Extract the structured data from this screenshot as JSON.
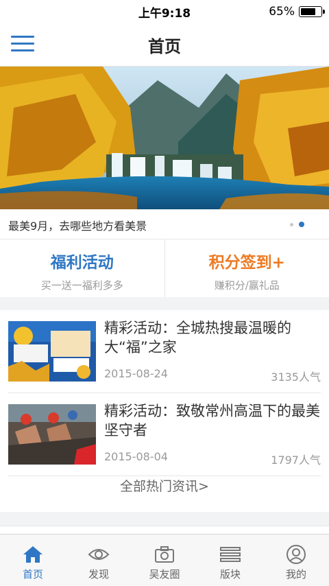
{
  "status": {
    "time": "上午9:18",
    "battery": "65%"
  },
  "header": {
    "title": "首页",
    "menu_icon": "hamburger-menu-icon"
  },
  "banner": {
    "caption": "最美9月，去哪些地方看美景",
    "slide_count": 2,
    "active_slide": 2
  },
  "promo": [
    {
      "title": "福利活动",
      "subtitle": "买一送一福利多多",
      "color": "#2f77c4"
    },
    {
      "title": "积分签到+",
      "subtitle": "赚积分/赢礼品",
      "color": "#ee7a22"
    }
  ],
  "news": {
    "items": [
      {
        "title": "精彩活动：全城热搜最温暖的大“福”之家",
        "date": "2015-08-24",
        "views": "3135",
        "views_unit": "人气"
      },
      {
        "title": "精彩活动：致敬常州高温下的最美坚守者",
        "date": "2015-08-04",
        "views": "1797",
        "views_unit": "人气"
      }
    ],
    "more_label": "全部热门资讯>"
  },
  "tabs": [
    {
      "label": "首页",
      "icon": "home-icon",
      "active": true
    },
    {
      "label": "发现",
      "icon": "eye-icon",
      "active": false
    },
    {
      "label": "吴友圈",
      "icon": "camera-icon",
      "active": false
    },
    {
      "label": "版块",
      "icon": "list-icon",
      "active": false
    },
    {
      "label": "我的",
      "icon": "user-icon",
      "active": false
    }
  ],
  "colors": {
    "accent": "#2f77c4",
    "orange": "#ee7a22"
  }
}
